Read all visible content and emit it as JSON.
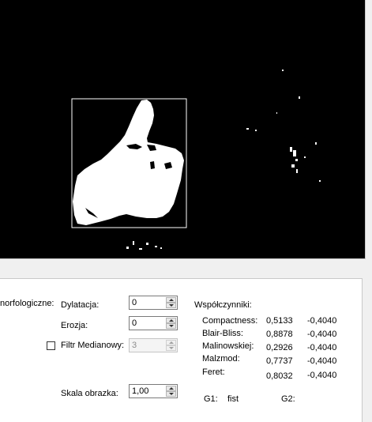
{
  "morph": {
    "group_label": "norfologiczne:",
    "dylatacja_label": "Dylatacja:",
    "dylatacja_value": "0",
    "erozja_label": "Erozja:",
    "erozja_value": "0",
    "filtr_label": "Filtr Medianowy:",
    "filtr_value": "3",
    "filtr_checked": false,
    "skala_label": "Skala obrazka:",
    "skala_value": "1,00"
  },
  "coef": {
    "title": "Współczynniki:",
    "rows": [
      {
        "name": "Compactness:",
        "value": "0,5133",
        "diff": "-0,4040"
      },
      {
        "name": "Blair-Bliss:",
        "value": "0,8878",
        "diff": "-0,4040"
      },
      {
        "name": "Malinowskiej:",
        "value": "0,2926",
        "diff": "-0,4040"
      },
      {
        "name": "Malzmod:",
        "value": "0,7737",
        "diff": "-0,4040"
      },
      {
        "name": "Feret:",
        "value": "0,8032",
        "diff": "-0,4040"
      }
    ],
    "g1_label": "G1:",
    "g1_value": "fist",
    "g2_label": "G2:"
  },
  "colors": {
    "viewport_bg": "#000000",
    "blob": "#ffffff",
    "bbox": "#ffffff",
    "panel_bg": "#ffffff"
  }
}
